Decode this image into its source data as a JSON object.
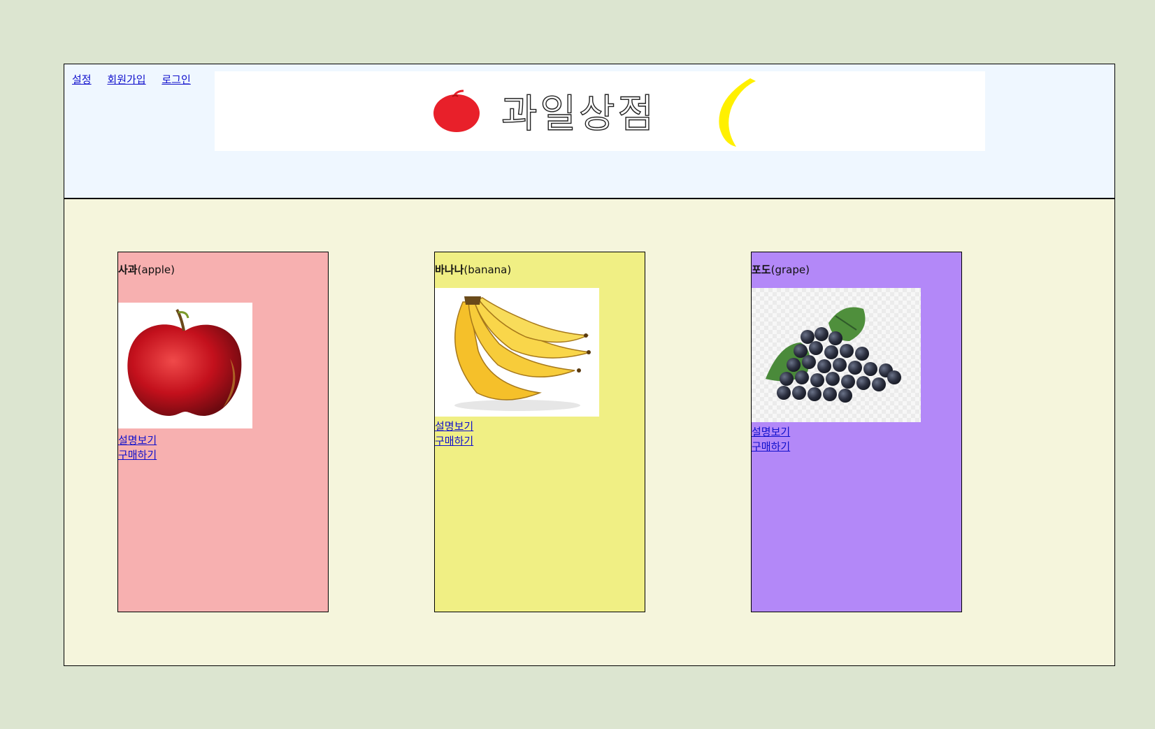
{
  "nav": {
    "settings": "설정",
    "signup": "회원가입",
    "login": "로그인"
  },
  "banner": {
    "title": "과일상점"
  },
  "products": [
    {
      "name_ko": "사과",
      "name_en": "(apple)",
      "bg": "#f7b0b0",
      "view_label": "설명보기",
      "buy_label": "구매하기"
    },
    {
      "name_ko": "바나나",
      "name_en": "(banana)",
      "bg": "#f0ef84",
      "view_label": "설명보기",
      "buy_label": "구매하기"
    },
    {
      "name_ko": "포도",
      "name_en": "(grape)",
      "bg": "#b388f8",
      "view_label": "설명보기",
      "buy_label": "구매하기"
    }
  ],
  "colors": {
    "page_bg": "#dce5d0",
    "header_bg": "#eff7ff",
    "main_bg": "#f5f5dc",
    "link": "#1010cc"
  }
}
